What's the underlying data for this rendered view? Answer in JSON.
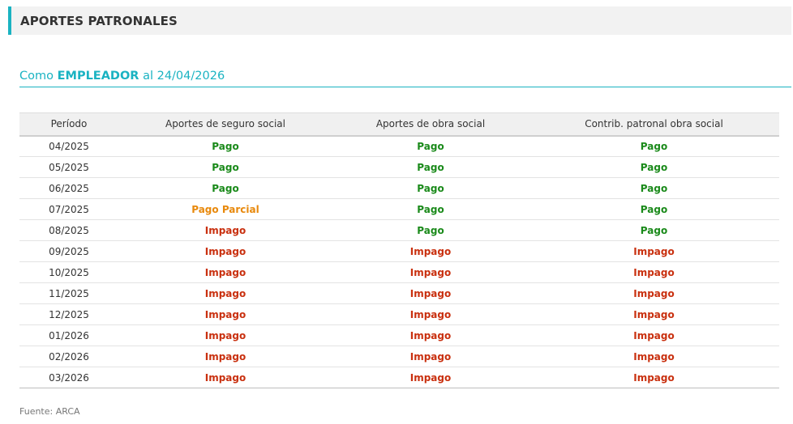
{
  "header": {
    "title": "APORTES PATRONALES"
  },
  "subtitle": {
    "prefix": "Como ",
    "role": "EMPLEADOR",
    "suffix": " al 24/04/2026"
  },
  "colors": {
    "accent": "#1ab3c2",
    "pago": "#1a8a1a",
    "parcial": "#e8890c",
    "impago": "#c9300f"
  },
  "table": {
    "headers": [
      "Período",
      "Aportes de seguro social",
      "Aportes de obra social",
      "Contrib. patronal obra social"
    ],
    "rows": [
      {
        "period": "04/2025",
        "seguro": "Pago",
        "obra": "Pago",
        "contrib": "Pago"
      },
      {
        "period": "05/2025",
        "seguro": "Pago",
        "obra": "Pago",
        "contrib": "Pago"
      },
      {
        "period": "06/2025",
        "seguro": "Pago",
        "obra": "Pago",
        "contrib": "Pago"
      },
      {
        "period": "07/2025",
        "seguro": "Pago Parcial",
        "obra": "Pago",
        "contrib": "Pago"
      },
      {
        "period": "08/2025",
        "seguro": "Impago",
        "obra": "Pago",
        "contrib": "Pago"
      },
      {
        "period": "09/2025",
        "seguro": "Impago",
        "obra": "Impago",
        "contrib": "Impago"
      },
      {
        "period": "10/2025",
        "seguro": "Impago",
        "obra": "Impago",
        "contrib": "Impago"
      },
      {
        "period": "11/2025",
        "seguro": "Impago",
        "obra": "Impago",
        "contrib": "Impago"
      },
      {
        "period": "12/2025",
        "seguro": "Impago",
        "obra": "Impago",
        "contrib": "Impago"
      },
      {
        "period": "01/2026",
        "seguro": "Impago",
        "obra": "Impago",
        "contrib": "Impago"
      },
      {
        "period": "02/2026",
        "seguro": "Impago",
        "obra": "Impago",
        "contrib": "Impago"
      },
      {
        "period": "03/2026",
        "seguro": "Impago",
        "obra": "Impago",
        "contrib": "Impago"
      }
    ]
  },
  "footer": {
    "source": "Fuente: ARCA"
  }
}
